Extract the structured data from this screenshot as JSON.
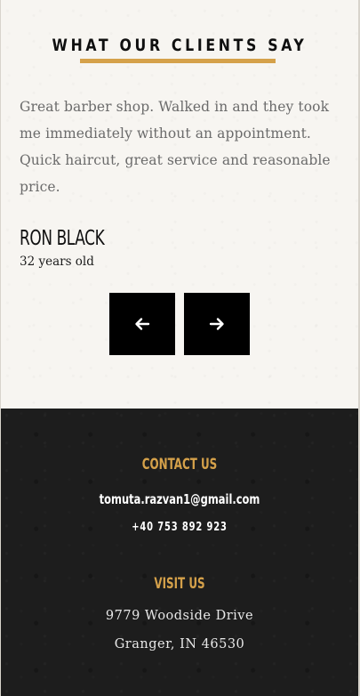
{
  "testimonials": {
    "title": "WHAT OUR CLIENTS SAY",
    "quote": "Great barber shop. Walked in and they took me immediately without an appointment. Quick haircut, great service and reasonable price.",
    "author": "RON BLACK",
    "author_detail": "32 years old",
    "prev_icon": "arrow-left-icon",
    "next_icon": "arrow-right-icon"
  },
  "footer": {
    "contact": {
      "heading": "CONTACT US",
      "email": "tomuta.razvan1@gmail.com",
      "phone": "+40 753 892 923"
    },
    "visit": {
      "heading": "VISIT US",
      "address_line1": "9779 Woodside Drive",
      "address_line2": "Granger, IN 46530"
    }
  },
  "colors": {
    "accent": "#d5a14a",
    "light_bg": "#f7f5f1",
    "dark_bg": "#1d1d1d",
    "button_bg": "#000000"
  }
}
